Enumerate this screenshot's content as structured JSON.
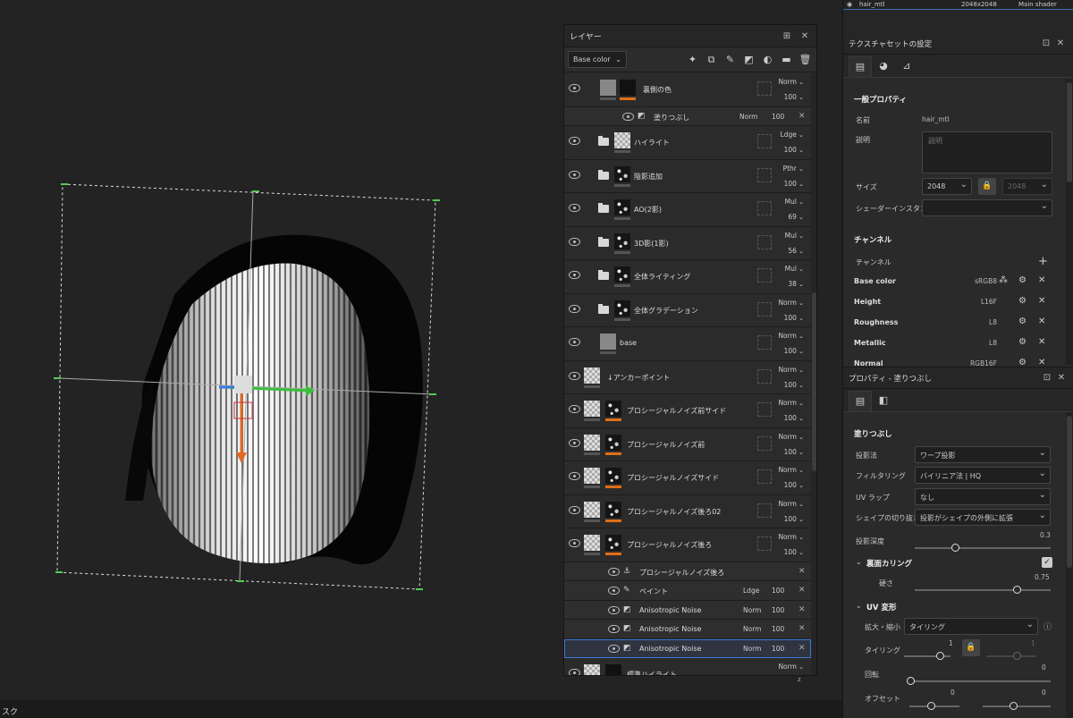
{
  "viewport": {
    "status_label": "スク",
    "axis_label": "z"
  },
  "layers_panel": {
    "title": "レイヤー",
    "channel_select": "Base color",
    "rows": [
      {
        "name": "裏側の色",
        "blend": "Norm",
        "opacity": "100",
        "visible": true,
        "kind": "fill-grey"
      },
      {
        "name": "塗りつぶし",
        "blend": "Norm",
        "opacity": "100",
        "visible": true,
        "kind": "sub"
      },
      {
        "name": "ハイライト",
        "blend": "Ldge",
        "opacity": "100",
        "visible": true,
        "kind": "folder"
      },
      {
        "name": "陰影追加",
        "blend": "Pthr",
        "opacity": "100",
        "visible": true,
        "kind": "folder"
      },
      {
        "name": "AO(2影)",
        "blend": "Mul",
        "opacity": "69",
        "visible": true,
        "kind": "folder"
      },
      {
        "name": "3D影(1影)",
        "blend": "Mul",
        "opacity": "56",
        "visible": true,
        "kind": "folder"
      },
      {
        "name": "全体ライティング",
        "blend": "Mul",
        "opacity": "38",
        "visible": true,
        "kind": "folder"
      },
      {
        "name": "全体グラデーション",
        "blend": "Norm",
        "opacity": "100",
        "visible": true,
        "kind": "folder"
      },
      {
        "name": "base",
        "blend": "Norm",
        "opacity": "100",
        "visible": true,
        "kind": "grey"
      },
      {
        "name": "↓アンカーポイント",
        "blend": "Norm",
        "opacity": "100",
        "visible": true,
        "kind": "checker"
      },
      {
        "name": "プロシージャルノイズ前サイド",
        "blend": "Norm",
        "opacity": "100",
        "visible": true,
        "kind": "noise"
      },
      {
        "name": "プロシージャルノイズ前",
        "blend": "Norm",
        "opacity": "100",
        "visible": true,
        "kind": "noise"
      },
      {
        "name": "プロシージャルノイズサイド",
        "blend": "Norm",
        "opacity": "100",
        "visible": true,
        "kind": "noise"
      },
      {
        "name": "プロシージャルノイズ後ろ02",
        "blend": "Norm",
        "opacity": "100",
        "visible": true,
        "kind": "noise"
      },
      {
        "name": "プロシージャルノイズ後ろ",
        "blend": "Norm",
        "opacity": "100",
        "visible": true,
        "kind": "noise"
      }
    ],
    "sub_rows": [
      {
        "name": "プロシージャルノイズ後ろ",
        "blend": "",
        "opacity": "",
        "icon": "anchor-icon"
      },
      {
        "name": "ペイント",
        "blend": "Ldge",
        "opacity": "100",
        "icon": "brush-icon"
      },
      {
        "name": "Anisotropic Noise",
        "blend": "Norm",
        "opacity": "100",
        "icon": "fill-icon"
      },
      {
        "name": "Anisotropic Noise",
        "blend": "Norm",
        "opacity": "100",
        "icon": "fill-icon"
      },
      {
        "name": "Anisotropic Noise",
        "blend": "Norm",
        "opacity": "100",
        "icon": "fill-icon"
      }
    ],
    "last_row": {
      "name": "標準ハイライト",
      "blend": "Norm"
    }
  },
  "texture_set_list": {
    "name": "hair_mtl",
    "size": "2048x2048",
    "shader": "Main shader"
  },
  "texture_set_settings": {
    "title": "テクスチャセットの設定",
    "section_general": "一般プロパティ",
    "name_label": "名前",
    "name_value": "hair_mtl",
    "desc_label": "説明",
    "desc_placeholder": "説明",
    "size_label": "サイズ",
    "size_value": "2048",
    "size_value2": "2048",
    "shader_label": "シェーダーインスタンス",
    "section_channels": "チャンネル",
    "channel_label": "チャンネル",
    "channels": [
      {
        "name": "Base color",
        "format": "sRGB8"
      },
      {
        "name": "Height",
        "format": "L16F"
      },
      {
        "name": "Roughness",
        "format": "L8"
      },
      {
        "name": "Metallic",
        "format": "L8"
      },
      {
        "name": "Normal",
        "format": "RGB16F"
      }
    ]
  },
  "properties_fill": {
    "title": "プロパティ - 塗りつぶし",
    "section": "塗りつぶし",
    "projection_label": "投影法",
    "projection_value": "ワープ投影",
    "filter_label": "フィルタリング",
    "filter_value": "バイリニア法 | HQ",
    "uvwrap_label": "UV ラップ",
    "uvwrap_value": "なし",
    "shape_label": "シェイプの切り抜き",
    "shape_value": "投影がシェイプの外側に拡張",
    "depth_label": "投影深度",
    "depth_value": "0.3",
    "backface_label": "裏面カリング",
    "hardness_label": "硬さ",
    "hardness_value": "0.75",
    "uv_section": "UV 変形",
    "scale_label": "拡大・縮小",
    "scale_value": "タイリング",
    "tiling_label": "タイリング",
    "tiling_value": "1",
    "tiling_value2": "1",
    "rotation_label": "回転",
    "rotation_value": "0",
    "offset_label": "オフセット",
    "offset_value": "0",
    "offset_value2": "0",
    "depth_level": 0.3,
    "hardness_level": 0.75
  }
}
